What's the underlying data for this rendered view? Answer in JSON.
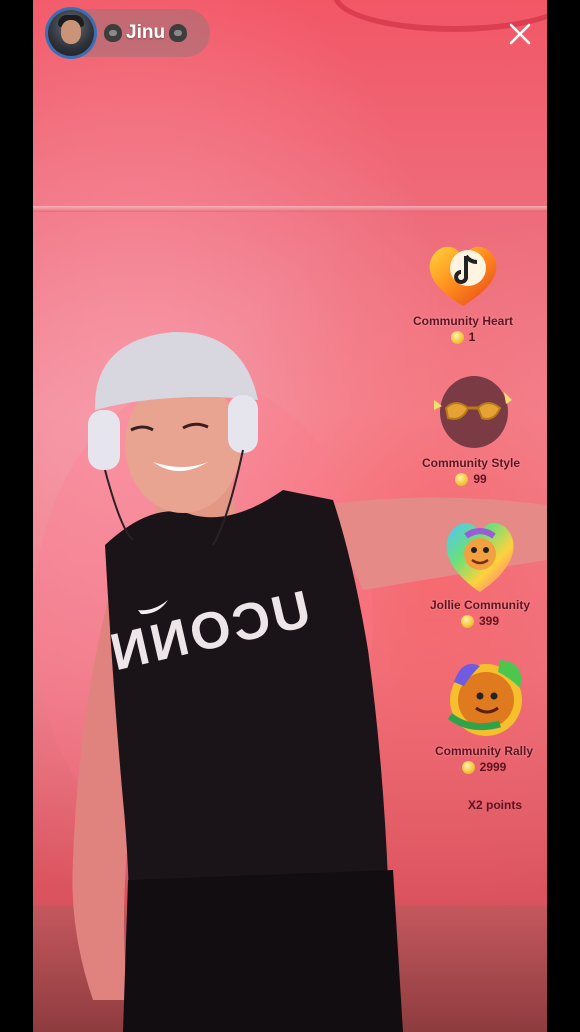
{
  "header": {
    "host_name": "Jinu",
    "host_badge_left": "gorilla-emoji",
    "host_badge_right": "gorilla-emoji",
    "close_icon": "close-icon"
  },
  "gifts": [
    {
      "name": "Community Heart",
      "price": "1",
      "icon": "tiktok-heart-gift"
    },
    {
      "name": "Community Style",
      "price": "99",
      "icon": "sunglasses-face-gift"
    },
    {
      "name": "Jollie Community",
      "price": "399",
      "icon": "rainbow-heart-character-gift"
    },
    {
      "name": "Community Rally",
      "price": "2999",
      "icon": "rally-character-gift"
    }
  ],
  "promo_text": "X2 points",
  "colors": {
    "background_pink": "#ef7888",
    "accent_blue": "#3a6fb8",
    "gift_text": "#5c1520",
    "coin": "#f5c842"
  }
}
